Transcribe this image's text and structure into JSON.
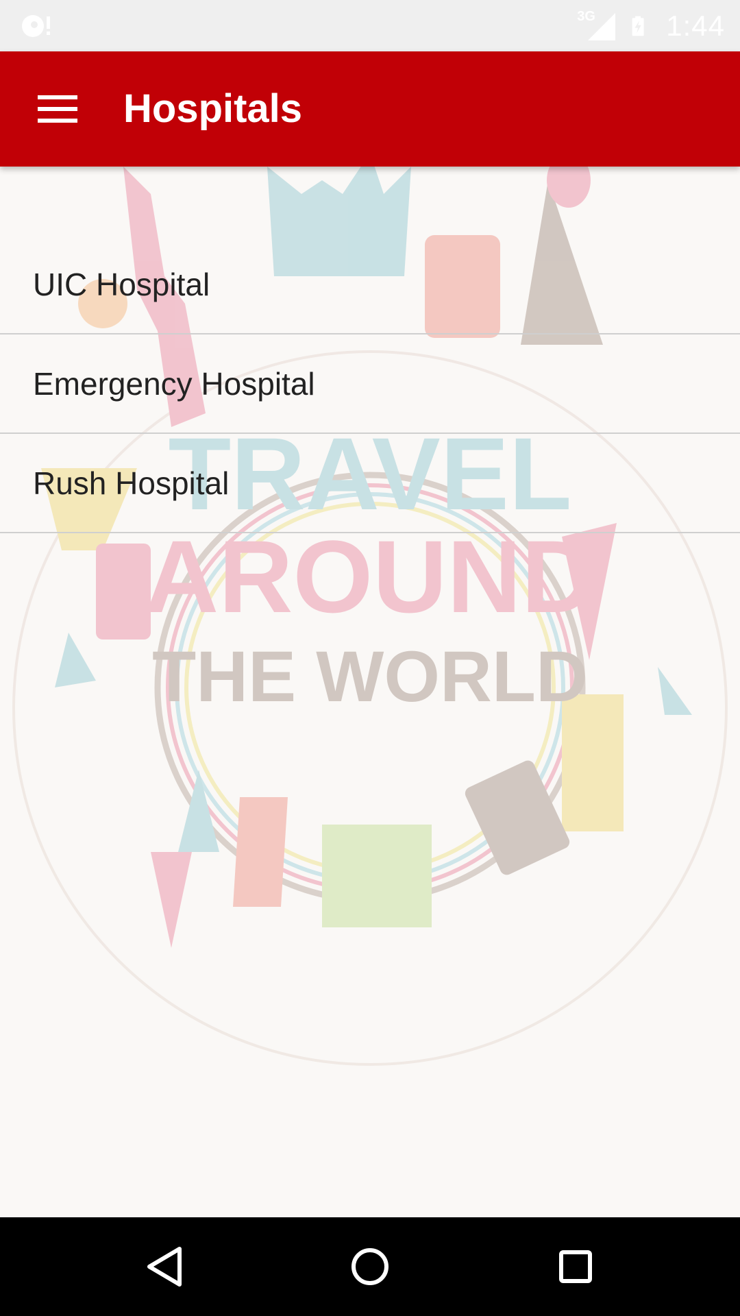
{
  "status_bar": {
    "time": "1:44",
    "network_label": "3G",
    "icons": [
      "notification-icon",
      "signal-3g-icon",
      "battery-charging-icon"
    ]
  },
  "app_bar": {
    "title": "Hospitals",
    "menu_icon": "hamburger-menu-icon",
    "background_color": "#c10006"
  },
  "hospitals": [
    {
      "name": "UIC Hospital"
    },
    {
      "name": "Emergency Hospital"
    },
    {
      "name": "Rush Hospital"
    }
  ],
  "background_art": {
    "lines": [
      "TRAVEL",
      "AROUND",
      "THE WORLD"
    ]
  },
  "nav_bar": {
    "icons": [
      "back-icon",
      "home-icon",
      "recent-apps-icon"
    ]
  }
}
